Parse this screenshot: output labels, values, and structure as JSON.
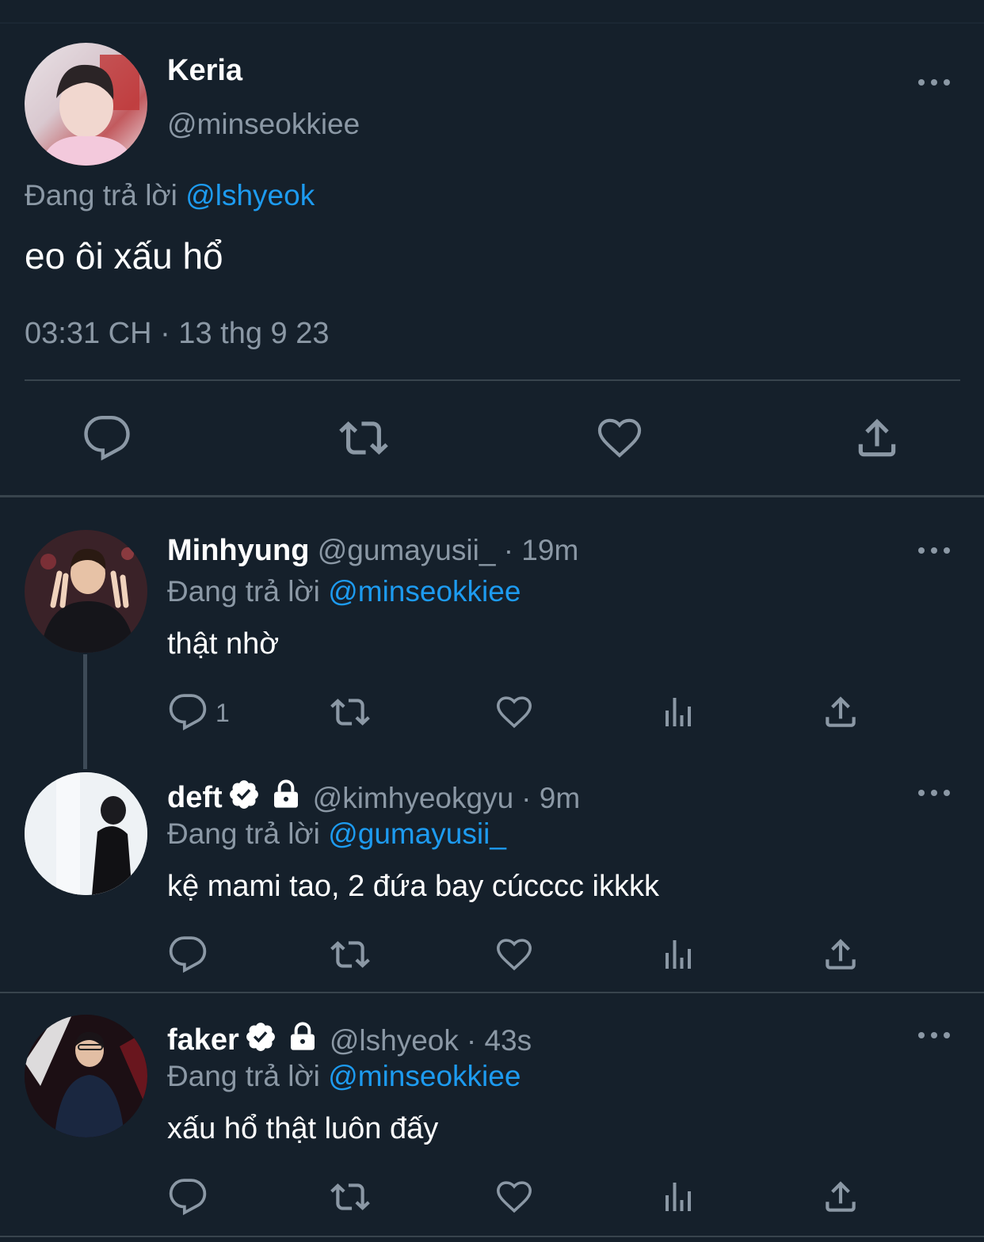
{
  "colors": {
    "background": "#15202b",
    "accent": "#1d9bf0",
    "muted": "#8b98a5",
    "divider": "#38444d"
  },
  "main_tweet": {
    "name": "Keria",
    "handle": "@minseokkiee",
    "reply_prefix": "Đang trả lời",
    "reply_to": "@lshyeok",
    "text": "eo ôi xấu hổ",
    "timestamp": "03:31 CH · 13 thg 9 23",
    "actions": [
      "reply-icon",
      "retweet-icon",
      "like-icon",
      "share-icon"
    ]
  },
  "replies": [
    {
      "name": "Minhyung",
      "handle": "@gumayusii_",
      "time": "· 19m",
      "reply_prefix": "Đang trả lời",
      "reply_to": "@minseokkiee",
      "text": "thật nhờ",
      "reply_count": "1",
      "verified": false,
      "protected": false
    },
    {
      "name": "deft",
      "handle": "@kimhyeokgyu",
      "time": "· 9m",
      "reply_prefix": "Đang trả lời",
      "reply_to": "@gumayusii_",
      "text": "kệ mami tao, 2 đứa bay cúcccc ikkkk",
      "reply_count": "",
      "verified": true,
      "protected": true
    },
    {
      "name": "faker",
      "handle": "@lshyeok",
      "time": "· 43s",
      "reply_prefix": "Đang trả lời",
      "reply_to": "@minseokkiee",
      "text": "xấu hổ thật luôn đấy",
      "reply_count": "",
      "verified": true,
      "protected": true
    }
  ]
}
